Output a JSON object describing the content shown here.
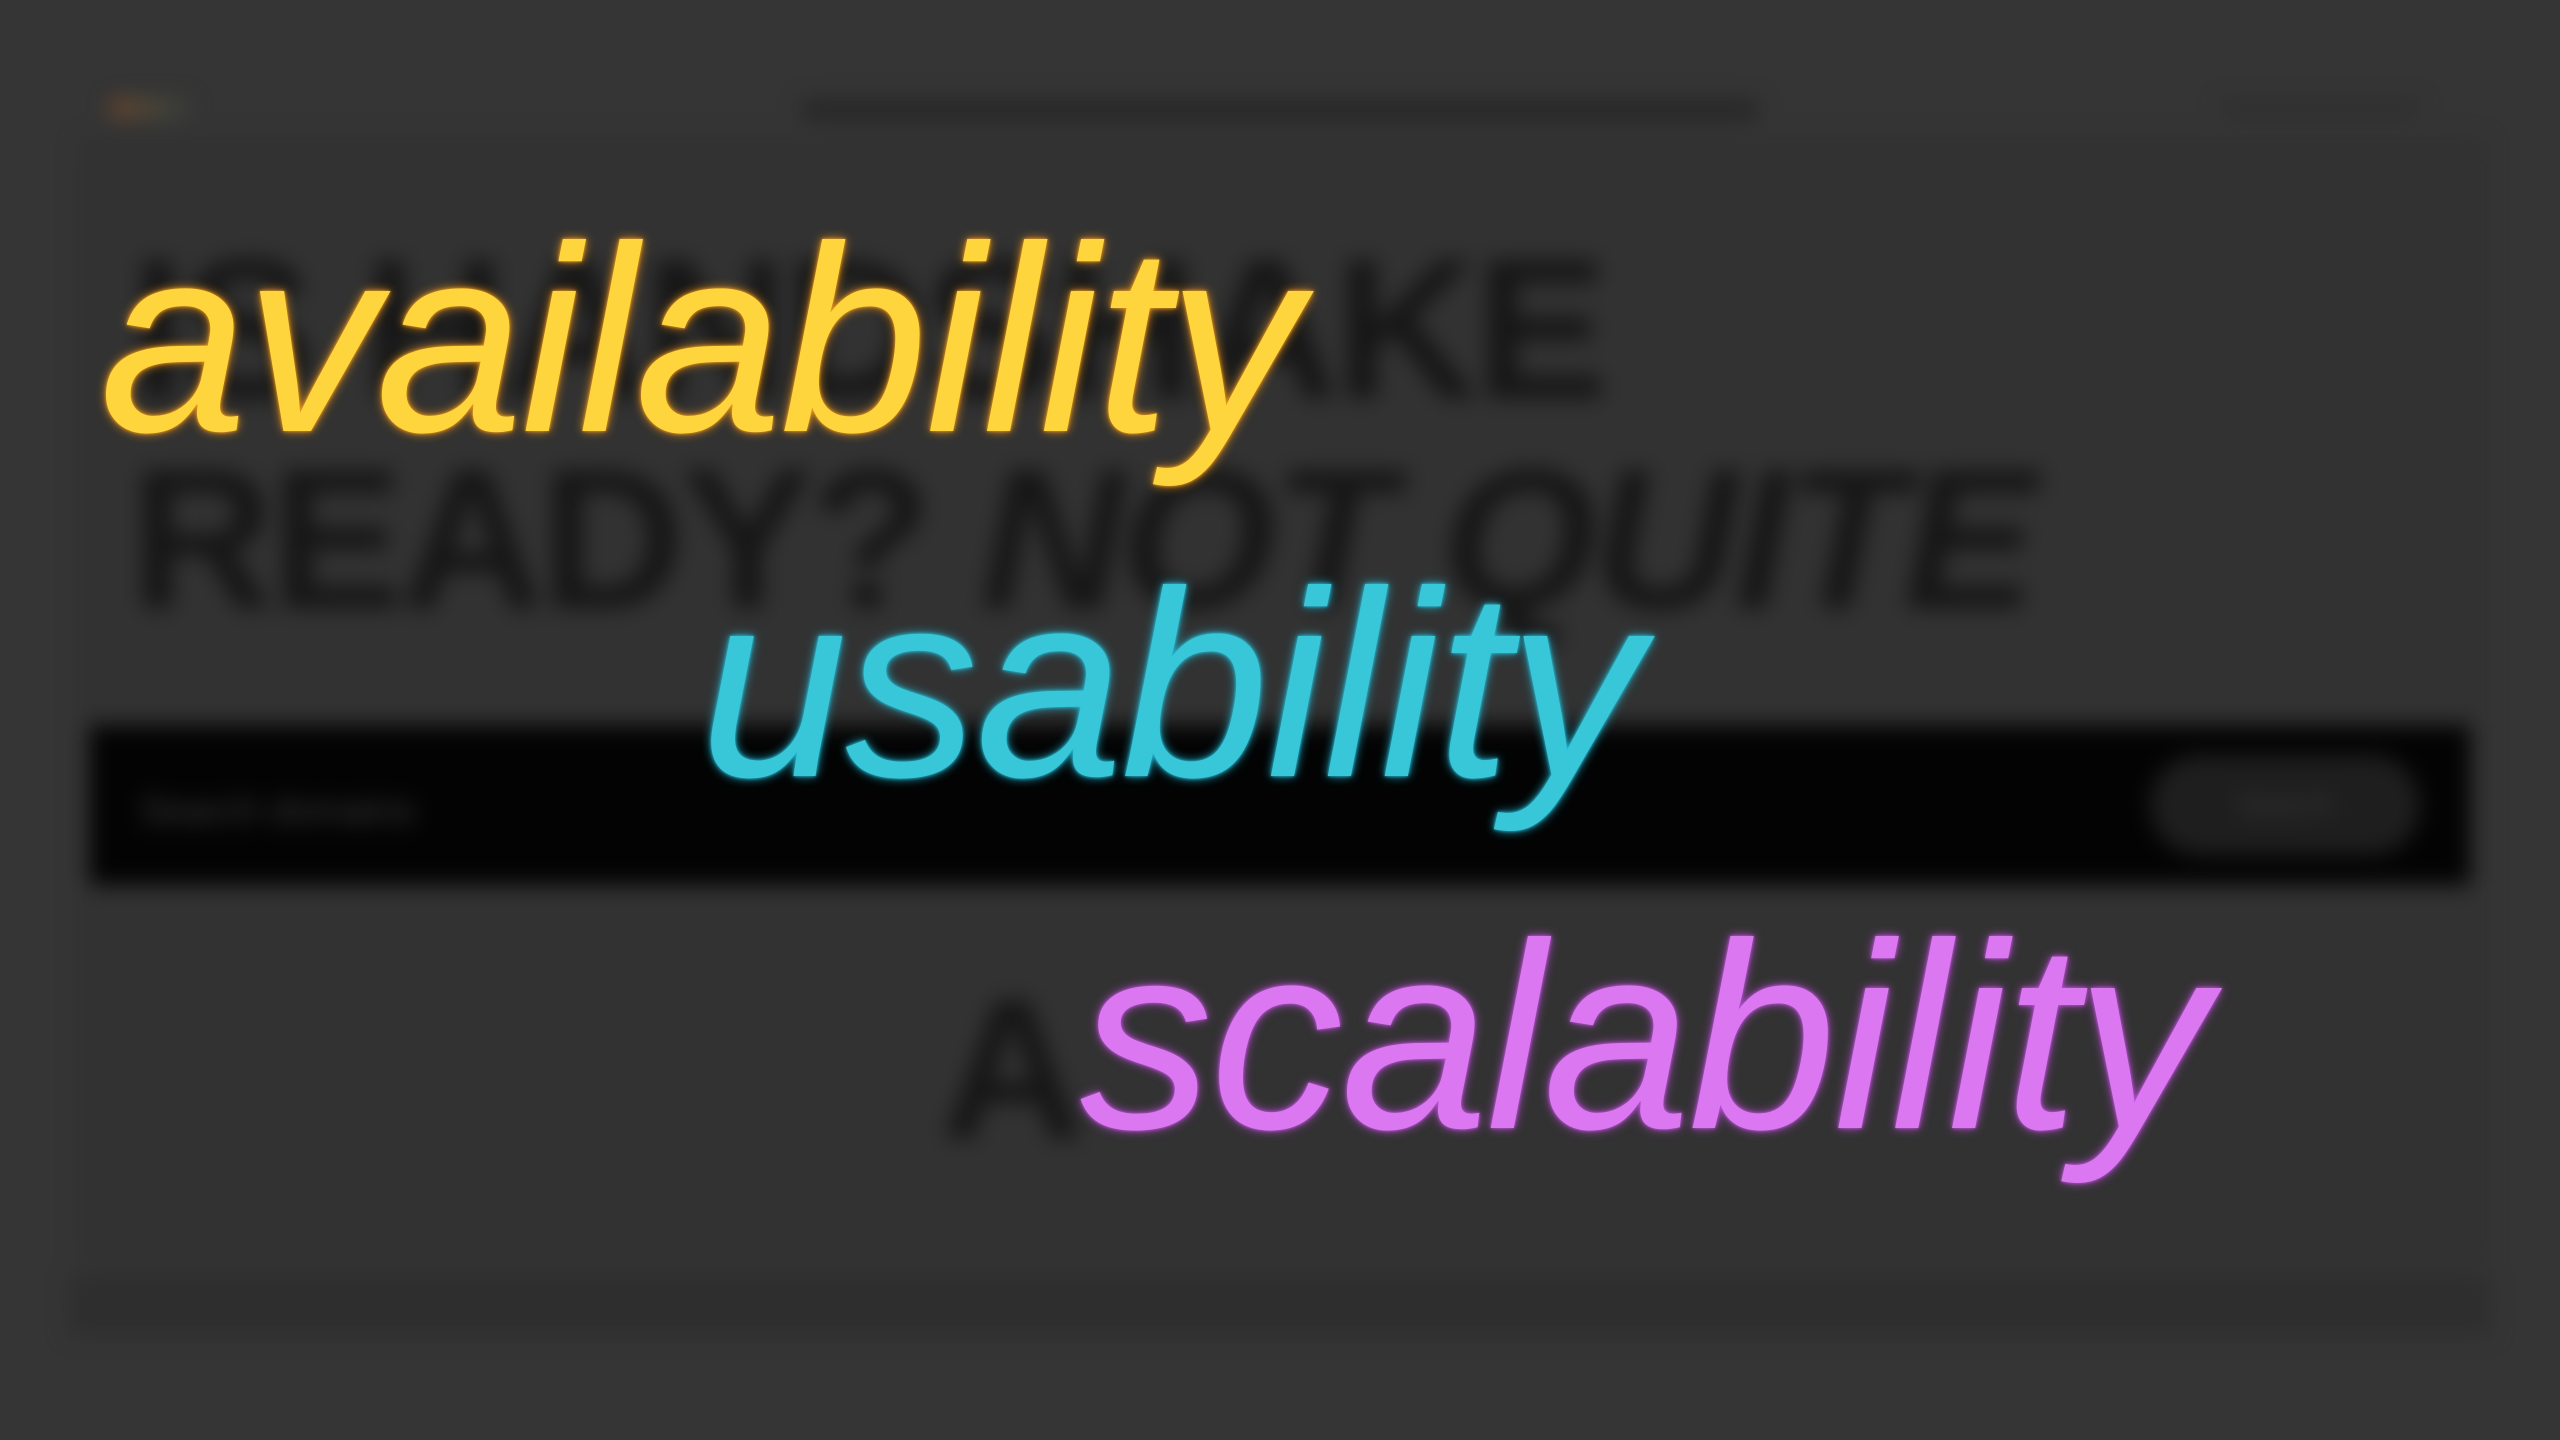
{
  "background": {
    "heading_line_1": "IS HANDSHAKE",
    "heading_line_2_a": "READY?",
    "heading_line_2_b": "NOT QUITE",
    "heading_line_3": "A",
    "search_placeholder": "Search domains",
    "search_button": "Search"
  },
  "overlay": {
    "word_1": "availability",
    "word_2": "usability",
    "word_3": "scalability"
  },
  "colors": {
    "background": "#353535",
    "availability": "#ffd53d",
    "usability": "#38c7d8",
    "scalability": "#dc77f2"
  }
}
